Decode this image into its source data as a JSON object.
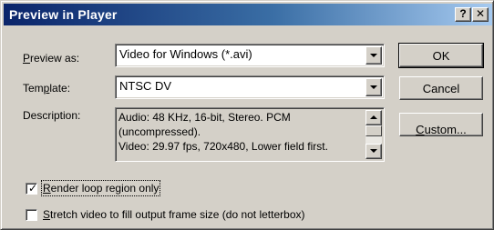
{
  "window": {
    "title": "Preview in Player",
    "help_glyph": "?",
    "close_glyph": "✕"
  },
  "preview_as": {
    "label_pre": "",
    "label_accel": "P",
    "label_post": "review as:",
    "value": "Video for Windows (*.avi)"
  },
  "template": {
    "label_pre": "Tem",
    "label_accel": "p",
    "label_post": "late:",
    "value": "NTSC DV"
  },
  "description": {
    "label": "Description:",
    "lines": [
      "Audio: 48 KHz, 16-bit, Stereo. PCM",
      "(uncompressed).",
      "Video: 29.97 fps, 720x480, Lower field first."
    ]
  },
  "buttons": {
    "ok": "OK",
    "cancel": "Cancel",
    "custom_accel": "C",
    "custom_rest": "ustom..."
  },
  "options": {
    "render_loop": {
      "accel": "R",
      "rest": "ender loop region only",
      "checked": true
    },
    "stretch": {
      "accel": "S",
      "rest": "tretch video to fill output frame size (do not letterbox)",
      "checked": false
    }
  }
}
